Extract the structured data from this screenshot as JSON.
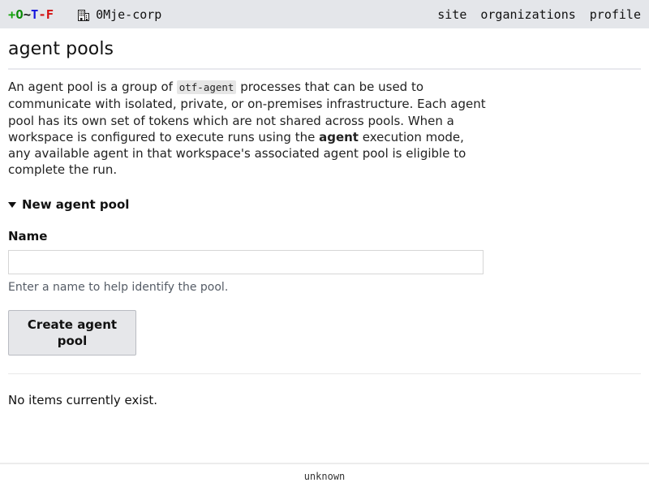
{
  "header": {
    "brand": {
      "icon_name": "otf-logo",
      "chars": [
        {
          "text": "+",
          "color": "#13a40b"
        },
        {
          "text": "O",
          "color": "#0b8a07"
        },
        {
          "text": "~",
          "color": "#111111"
        },
        {
          "text": "T",
          "color": "#1515dd"
        },
        {
          "text": "-",
          "color": "#d41111"
        },
        {
          "text": "F",
          "color": "#d41111"
        }
      ]
    },
    "organization": {
      "icon": "building-icon",
      "name": "0Mje-corp"
    },
    "nav": [
      {
        "label": "site"
      },
      {
        "label": "organizations"
      },
      {
        "label": "profile"
      }
    ]
  },
  "main": {
    "title": "agent pools",
    "intro": {
      "part1": "An agent pool is a group of ",
      "code": "otf-agent",
      "part2": " processes that can be used to communicate with isolated, private, or on-premises infrastructure. Each agent pool has its own set of tokens which are not shared across pools. When a workspace is configured to execute runs using the ",
      "bold": "agent",
      "part3": " execution mode, any available agent in that workspace's associated agent pool is eligible to complete the run."
    },
    "new_pool": {
      "summary_label": "New agent pool",
      "marker": "▼",
      "name_label": "Name",
      "name_value": "",
      "name_placeholder": "",
      "name_hint": "Enter a name to help identify the pool.",
      "submit_label": "Create agent pool"
    },
    "empty_message": "No items currently exist."
  },
  "footer": {
    "version": "unknown"
  }
}
